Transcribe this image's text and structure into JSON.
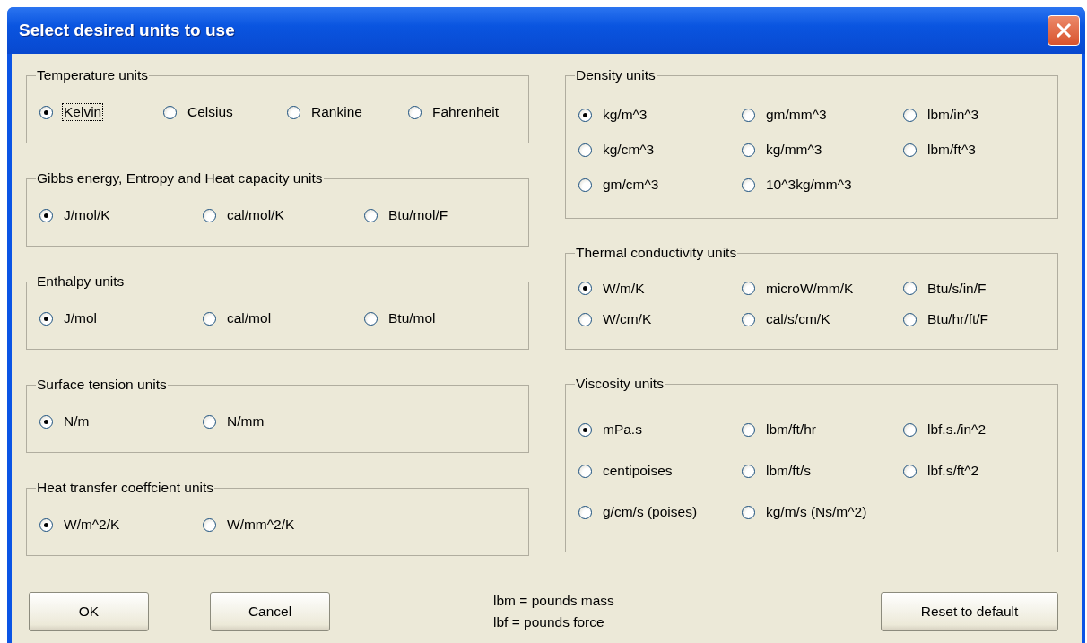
{
  "window": {
    "title": "Select desired units to use"
  },
  "left_groups": [
    {
      "title": "Temperature units",
      "options": [
        {
          "label": "Kelvin",
          "selected": true,
          "focused": true
        },
        {
          "label": "Celsius",
          "selected": false,
          "focused": false
        },
        {
          "label": "Rankine",
          "selected": false,
          "focused": false
        },
        {
          "label": "Fahrenheit",
          "selected": false,
          "focused": false
        }
      ]
    },
    {
      "title": "Gibbs energy, Entropy and Heat capacity units",
      "options": [
        {
          "label": "J/mol/K",
          "selected": true
        },
        {
          "label": "cal/mol/K",
          "selected": false
        },
        {
          "label": "Btu/mol/F",
          "selected": false
        }
      ]
    },
    {
      "title": "Enthalpy units",
      "options": [
        {
          "label": "J/mol",
          "selected": true
        },
        {
          "label": "cal/mol",
          "selected": false
        },
        {
          "label": "Btu/mol",
          "selected": false
        }
      ]
    },
    {
      "title": "Surface tension units",
      "options": [
        {
          "label": "N/m",
          "selected": true
        },
        {
          "label": "N/mm",
          "selected": false
        }
      ]
    },
    {
      "title": "Heat transfer coeffcient units",
      "options": [
        {
          "label": "W/m^2/K",
          "selected": true
        },
        {
          "label": "W/mm^2/K",
          "selected": false
        }
      ]
    }
  ],
  "right_groups": [
    {
      "title": "Density units",
      "options": [
        {
          "label": "kg/m^3",
          "selected": true
        },
        {
          "label": "gm/mm^3",
          "selected": false
        },
        {
          "label": "lbm/in^3",
          "selected": false
        },
        {
          "label": "kg/cm^3",
          "selected": false
        },
        {
          "label": "kg/mm^3",
          "selected": false
        },
        {
          "label": "lbm/ft^3",
          "selected": false
        },
        {
          "label": "gm/cm^3",
          "selected": false
        },
        {
          "label": "10^3kg/mm^3",
          "selected": false
        }
      ]
    },
    {
      "title": "Thermal conductivity units",
      "options": [
        {
          "label": "W/m/K",
          "selected": true
        },
        {
          "label": "microW/mm/K",
          "selected": false
        },
        {
          "label": "Btu/s/in/F",
          "selected": false
        },
        {
          "label": "W/cm/K",
          "selected": false
        },
        {
          "label": "cal/s/cm/K",
          "selected": false
        },
        {
          "label": "Btu/hr/ft/F",
          "selected": false
        }
      ]
    },
    {
      "title": "Viscosity units",
      "options": [
        {
          "label": "mPa.s",
          "selected": true
        },
        {
          "label": "lbm/ft/hr",
          "selected": false
        },
        {
          "label": "lbf.s./in^2",
          "selected": false
        },
        {
          "label": "centipoises",
          "selected": false
        },
        {
          "label": "lbm/ft/s",
          "selected": false
        },
        {
          "label": "lbf.s/ft^2",
          "selected": false
        },
        {
          "label": "g/cm/s (poises)",
          "selected": false
        },
        {
          "label": "kg/m/s (Ns/m^2)",
          "selected": false
        }
      ]
    }
  ],
  "buttons": {
    "ok": "OK",
    "cancel": "Cancel",
    "reset": "Reset to default"
  },
  "notes": [
    "lbm = pounds mass",
    "lbf = pounds force"
  ]
}
